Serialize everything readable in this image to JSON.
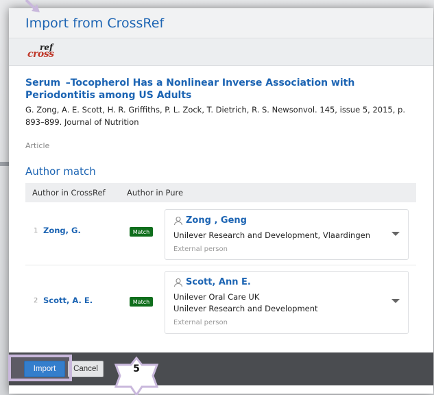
{
  "dialog": {
    "title": "Import from CrossRef"
  },
  "logo": {
    "cross": "cross",
    "ref": "ref"
  },
  "article": {
    "title": "Serum  –Tocopherol Has a Nonlinear Inverse Association with Periodontitis among US Adults",
    "meta": "G. Zong, A. E. Scott, H. R. Griffiths, P. L. Zock, T. Dietrich, R. S. Newsonvol. 145, issue 5, 2015, p. 893–899. Journal of Nutrition",
    "type": "Article"
  },
  "author_match": {
    "heading": "Author match",
    "col_crossref": "Author in CrossRef",
    "col_pure": "Author in Pure",
    "rows": [
      {
        "index": "1",
        "crossref_name": "Zong, G.",
        "match": "Match",
        "pure_name": "Zong , Geng",
        "org1": "Unilever Research and Development, Vlaardingen",
        "org2": "",
        "ext": "External person"
      },
      {
        "index": "2",
        "crossref_name": "Scott, A. E.",
        "match": "Match",
        "pure_name": "Scott, Ann E.",
        "org1": "Unilever Oral Care UK",
        "org2": "Unilever Research and Development",
        "ext": "External person"
      }
    ]
  },
  "footer": {
    "import_label": "Import",
    "cancel_label": "Cancel"
  },
  "tutorial": {
    "step": "5",
    "highlight_color": "#c9b8dc"
  },
  "colors": {
    "accent": "#1c64b3",
    "match_badge": "#0f6e1c",
    "primary_button": "#1b75c9",
    "footer": "#4a4c50"
  }
}
